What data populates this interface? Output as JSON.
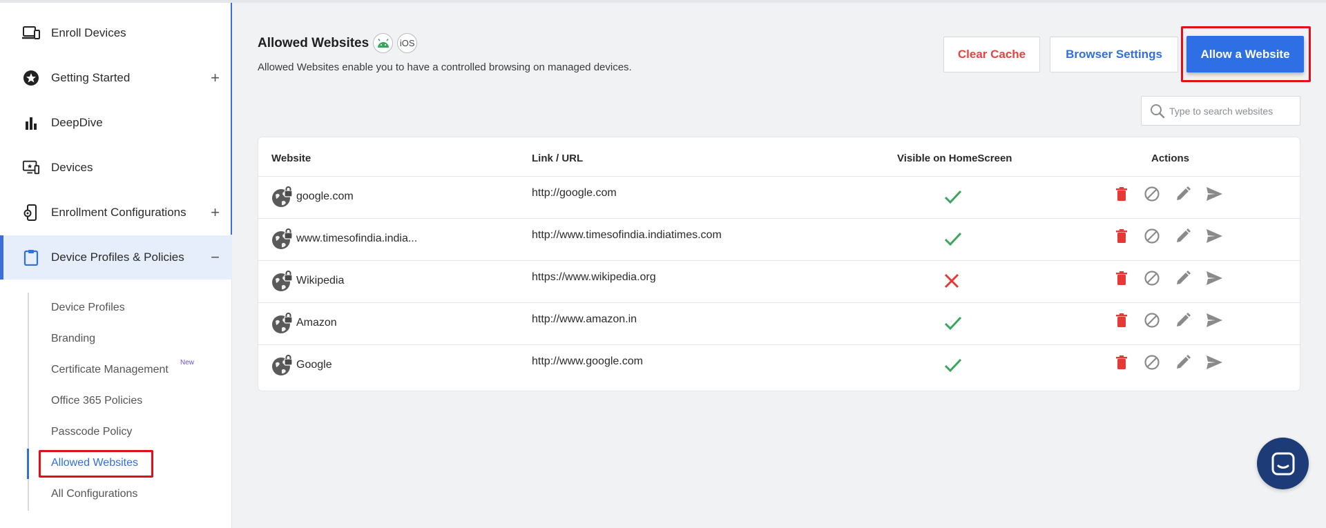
{
  "sidebar": {
    "items": [
      {
        "label": "Enroll Devices",
        "icon": "devices-icon"
      },
      {
        "label": "Getting Started",
        "icon": "star-icon",
        "expandable": "+"
      },
      {
        "label": "DeepDive",
        "icon": "bar-chart-icon"
      },
      {
        "label": "Devices",
        "icon": "monitor-icon"
      },
      {
        "label": "Enrollment Configurations",
        "icon": "phone-config-icon",
        "expandable": "+"
      },
      {
        "label": "Device Profiles & Policies",
        "icon": "clipboard-icon",
        "expandable": "−"
      }
    ],
    "sub_items": [
      {
        "label": "Device Profiles"
      },
      {
        "label": "Branding"
      },
      {
        "label": "Certificate Management",
        "badge": "New"
      },
      {
        "label": "Office 365 Policies"
      },
      {
        "label": "Passcode Policy"
      },
      {
        "label": "Allowed Websites"
      },
      {
        "label": "All Configurations"
      }
    ]
  },
  "header": {
    "title": "Allowed Websites",
    "ios_badge": "iOS",
    "subtitle": "Allowed Websites enable you to have a controlled browsing on managed devices."
  },
  "buttons": {
    "clear_cache": "Clear Cache",
    "browser_settings": "Browser Settings",
    "allow_website": "Allow a Website"
  },
  "search": {
    "placeholder": "Type to search websites"
  },
  "table": {
    "headers": {
      "website": "Website",
      "url": "Link / URL",
      "visible": "Visible on HomeScreen",
      "actions": "Actions"
    },
    "rows": [
      {
        "website": "google.com",
        "url": "http://google.com",
        "visible": true
      },
      {
        "website": "www.timesofindia.india...",
        "url": "http://www.timesofindia.indiatimes.com",
        "visible": true
      },
      {
        "website": "Wikipedia",
        "url": "https://www.wikipedia.org",
        "visible": false
      },
      {
        "website": "Amazon",
        "url": "http://www.amazon.in",
        "visible": true
      },
      {
        "website": "Google",
        "url": "http://www.google.com",
        "visible": true
      }
    ]
  },
  "colors": {
    "accent": "#2e6fe6",
    "danger": "#e74343",
    "check": "#3aa55c",
    "cross": "#e53935",
    "chat": "#1d3c77"
  }
}
